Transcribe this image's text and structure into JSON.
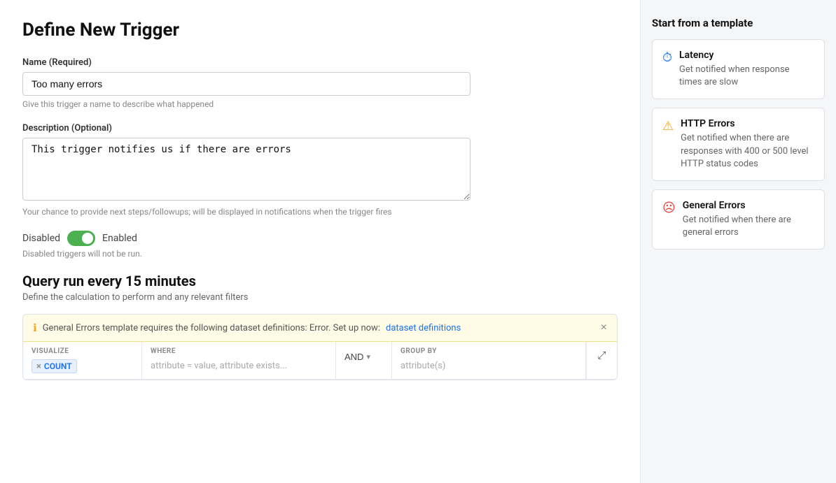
{
  "page": {
    "title": "Define New Trigger"
  },
  "form": {
    "name_label": "Name (Required)",
    "name_value": "Too many errors",
    "name_hint": "Give this trigger a name to describe what happened",
    "description_label": "Description (Optional)",
    "description_value": "This trigger notifies us if there are errors",
    "description_hint": "Your chance to provide next steps/followups; will be displayed in notifications when the trigger fires",
    "disabled_label": "Disabled",
    "enabled_label": "Enabled",
    "toggle_hint": "Disabled triggers will not be run."
  },
  "query": {
    "section_title": "Query run every 15 minutes",
    "section_desc": "Define the calculation to perform and any relevant filters",
    "alert_text": "General Errors template requires the following dataset definitions: Error. Set up now:",
    "alert_link": "dataset definitions",
    "visualize_label": "VISUALIZE",
    "where_label": "WHERE",
    "and_label": "AND",
    "groupby_label": "GROUP BY",
    "count_tag": "COUNT",
    "where_placeholder": "attribute = value, attribute exists...",
    "groupby_placeholder": "attribute(s)"
  },
  "sidebar": {
    "title": "Start from a template",
    "templates": [
      {
        "id": "latency",
        "icon": "⏱",
        "icon_type": "latency",
        "title": "Latency",
        "description": "Get notified when response times are slow"
      },
      {
        "id": "http-errors",
        "icon": "⚠",
        "icon_type": "http",
        "title": "HTTP Errors",
        "description": "Get notified when there are responses with 400 or 500 level HTTP status codes"
      },
      {
        "id": "general-errors",
        "icon": "☹",
        "icon_type": "errors",
        "title": "General Errors",
        "description": "Get notified when there are general errors"
      }
    ]
  }
}
